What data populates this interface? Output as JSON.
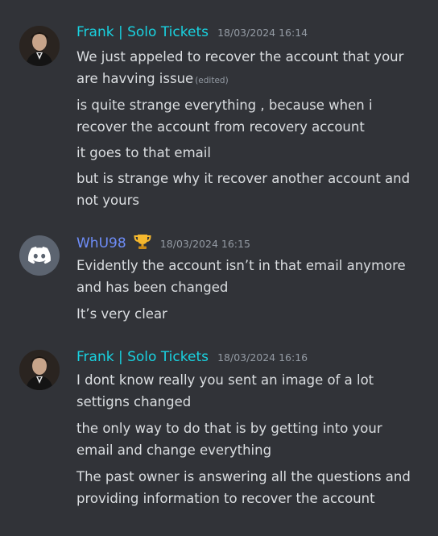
{
  "messages": [
    {
      "username": "Frank | Solo Tickets",
      "timestamp": "18/03/2024 16:14",
      "name_color": "#19d2e0",
      "avatar": "user-photo",
      "lines": [
        {
          "text": "We just appeled to recover the account that your are havving issue",
          "edited": "(edited)"
        },
        {
          "text": "is quite strange everything , because when i recover the account from recovery account"
        },
        {
          "text": "it goes to that email"
        },
        {
          "text": "but is strange why it recover another account and not yours"
        }
      ]
    },
    {
      "username": "WhU98",
      "timestamp": "18/03/2024 16:15",
      "name_color": "#6e8df8",
      "badge_icon": "trophy-icon",
      "avatar": "discord-logo-icon",
      "lines": [
        {
          "text": "Evidently the account isn’t in that email anymore and has been changed"
        },
        {
          "text": "It’s very clear"
        }
      ]
    },
    {
      "username": "Frank | Solo Tickets",
      "timestamp": "18/03/2024 16:16",
      "name_color": "#19d2e0",
      "avatar": "user-photo",
      "lines": [
        {
          "text": "I dont know really you sent an image of a lot settigns changed"
        },
        {
          "text": "the only way to do that is by getting into your email and change everything"
        },
        {
          "text": "The past owner is answering all the questions and providing information to recover the account"
        }
      ]
    }
  ]
}
